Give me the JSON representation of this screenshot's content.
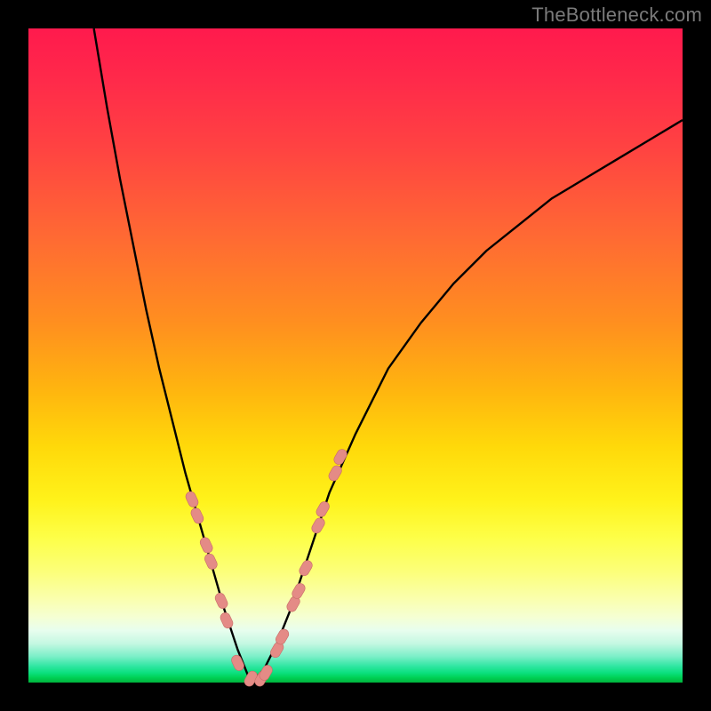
{
  "watermark": "TheBottleneck.com",
  "colors": {
    "curve_stroke": "#000000",
    "marker_fill": "#e48b86",
    "marker_stroke": "#c86d68"
  },
  "chart_data": {
    "type": "line",
    "title": "",
    "xlabel": "",
    "ylabel": "",
    "xlim": [
      0,
      100
    ],
    "ylim": [
      0,
      100
    ],
    "grid": false,
    "legend": false,
    "curve_minimum_x": 34,
    "curve_minimum_y": 0,
    "series": [
      {
        "name": "bottleneck-curve",
        "x": [
          10,
          12,
          14,
          16,
          18,
          20,
          22,
          24,
          26,
          28,
          30,
          32,
          34,
          36,
          38,
          40,
          42,
          44,
          46,
          50,
          55,
          60,
          65,
          70,
          75,
          80,
          85,
          90,
          95,
          100
        ],
        "y": [
          100,
          88,
          77,
          67,
          57,
          48,
          40,
          32,
          25,
          18,
          11,
          5,
          0,
          2,
          6,
          11,
          17,
          23,
          29,
          38,
          48,
          55,
          61,
          66,
          70,
          74,
          77,
          80,
          83,
          86
        ]
      }
    ],
    "markers": {
      "name": "highlight-points",
      "x": [
        25.0,
        25.8,
        27.2,
        27.9,
        29.5,
        30.3,
        32.0,
        34.0,
        35.6,
        36.3,
        38.0,
        38.8,
        40.5,
        41.3,
        42.4,
        44.3,
        45.0,
        46.9,
        47.7
      ],
      "y": [
        28.0,
        25.5,
        21.0,
        18.5,
        12.5,
        9.5,
        3.0,
        0.6,
        0.6,
        1.5,
        5.0,
        7.0,
        12.0,
        14.0,
        17.5,
        24.0,
        26.5,
        32.0,
        34.5
      ]
    }
  }
}
